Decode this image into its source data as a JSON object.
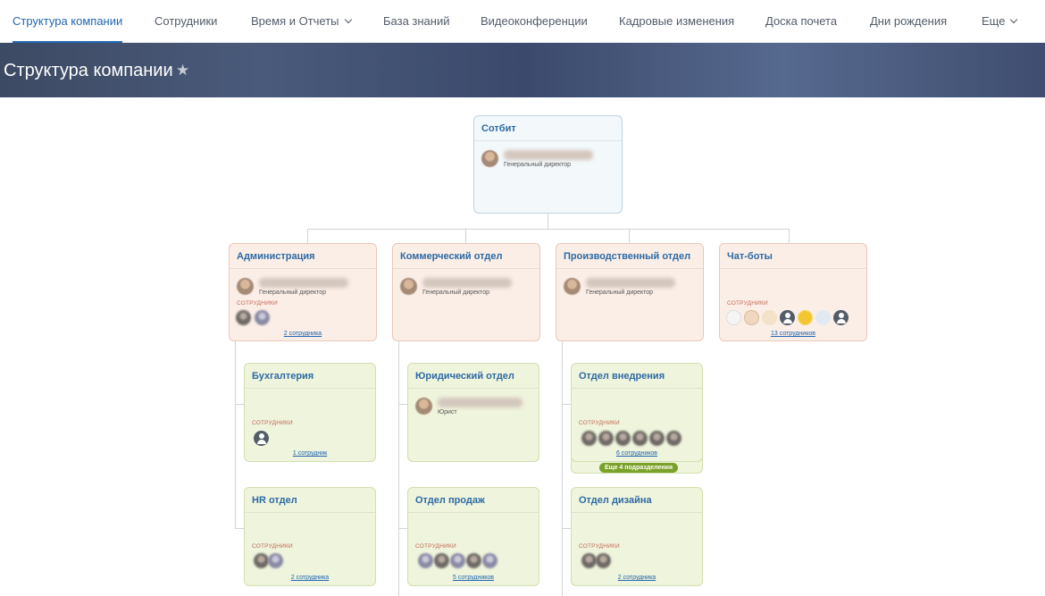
{
  "nav": {
    "items": [
      {
        "label": "Структура компании"
      },
      {
        "label": "Сотрудники"
      },
      {
        "label": "Время и Отчеты"
      },
      {
        "label": "База знаний"
      },
      {
        "label": "Видеоконференции"
      },
      {
        "label": "Кадровые изменения"
      },
      {
        "label": "Доска почета"
      },
      {
        "label": "Дни рождения"
      },
      {
        "label": "Еще"
      }
    ]
  },
  "page": {
    "title": "Структура компании"
  },
  "root": {
    "title": "Сотбит",
    "position": "Генеральный директор"
  },
  "departments": [
    {
      "title": "Администрация",
      "position": "Генеральный директор",
      "employees_label": "СОТРУДНИКИ",
      "count": "2 сотрудника"
    },
    {
      "title": "Коммерческий отдел",
      "position": "Генеральный директор"
    },
    {
      "title": "Производственный отдел",
      "position": "Генеральный директор"
    },
    {
      "title": "Чат-боты",
      "employees_label": "СОТРУДНИКИ",
      "count": "13 сотрудников"
    }
  ],
  "subdepartments": {
    "admin": [
      {
        "title": "Бухгалтерия",
        "employees_label": "СОТРУДНИКИ",
        "count": "1 сотрудник"
      },
      {
        "title": "HR отдел",
        "employees_label": "СОТРУДНИКИ",
        "count": "2 сотрудника"
      }
    ],
    "commercial": [
      {
        "title": "Юридический отдел",
        "position": "Юрист"
      },
      {
        "title": "Отдел продаж",
        "employees_label": "СОТРУДНИКИ",
        "count": "5 сотрудников"
      }
    ],
    "production": [
      {
        "title": "Отдел внедрения",
        "employees_label": "СОТРУДНИКИ",
        "count": "6 сотрудников",
        "more": "Еще 4 подразделения"
      },
      {
        "title": "Отдел дизайна",
        "employees_label": "СОТРУДНИКИ",
        "count": "2 сотрудника"
      }
    ]
  },
  "colors": {
    "accent": "#2067b0",
    "dept_bg": "#fbeee7",
    "sub_bg": "#eff4dc",
    "root_bg": "#f3f8fb"
  }
}
